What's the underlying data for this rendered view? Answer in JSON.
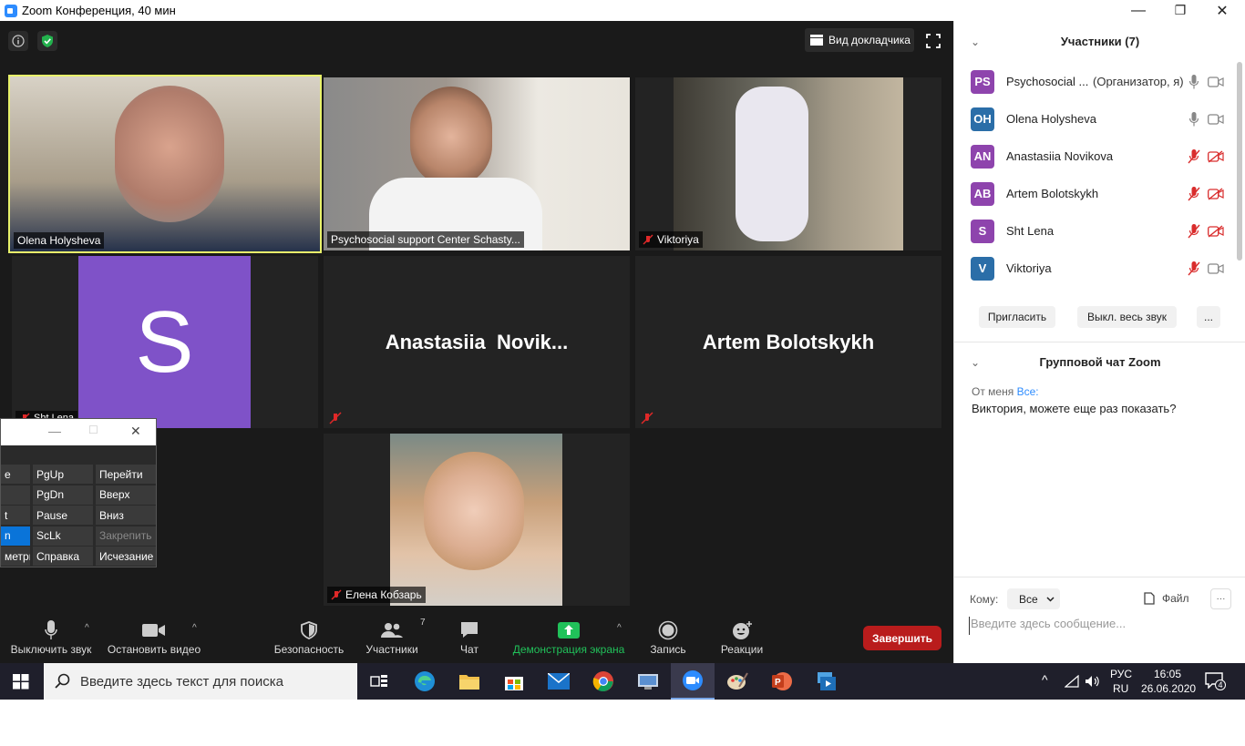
{
  "window": {
    "title": "Zoom Конференция, 40 мин",
    "minimize": "—",
    "maximize": "❐",
    "close": "✕"
  },
  "toolbar": {
    "speaker_view": "Вид докладчика"
  },
  "tiles": [
    {
      "name": "Olena Holysheva",
      "active": true
    },
    {
      "name": "Psychosocial support Center Schasty..."
    },
    {
      "name": "Viktoriya",
      "muted": true
    },
    {
      "name": "Sht Lena",
      "initial": "S",
      "muted": true
    },
    {
      "name": "Anastasiia  Novik...",
      "muted": true
    },
    {
      "name": "Artem Bolotskykh",
      "muted": true
    },
    {
      "name": "Елена Кобзарь",
      "muted": true
    }
  ],
  "keyboard": {
    "col1": [
      "e",
      "",
      "t",
      "n",
      "метрь"
    ],
    "col2": [
      "PgUp",
      "PgDn",
      "Pause",
      "ScLk",
      "Справка"
    ],
    "col3": [
      "Перейти",
      "Вверх",
      "Вниз",
      "Закрепить",
      "Исчезание"
    ]
  },
  "controls": {
    "mute": "Выключить звук",
    "video": "Остановить видео",
    "security": "Безопасность",
    "participants": "Участники",
    "participants_count": "7",
    "chat": "Чат",
    "share": "Демонстрация экрана",
    "record": "Запись",
    "reactions": "Реакции",
    "end": "Завершить"
  },
  "participants_panel": {
    "title": "Участники (7)",
    "people": [
      {
        "initials": "PS",
        "name": "Psychosocial ...",
        "role": "(Организатор, я)",
        "color": "#8e44ad",
        "mic": "on",
        "cam": "on"
      },
      {
        "initials": "OH",
        "name": "Olena Holysheva",
        "color": "#2b6ea8",
        "mic": "on",
        "cam": "on"
      },
      {
        "initials": "AN",
        "name": "Anastasiia Novikova",
        "color": "#8e44ad",
        "mic": "off",
        "cam": "off"
      },
      {
        "initials": "AB",
        "name": "Artem Bolotskykh",
        "color": "#8e44ad",
        "mic": "off",
        "cam": "off"
      },
      {
        "initials": "S",
        "name": "Sht Lena",
        "color": "#8e44ad",
        "mic": "off",
        "cam": "off"
      },
      {
        "initials": "V",
        "name": "Viktoriya",
        "color": "#2b6ea8",
        "mic": "off",
        "cam": "on"
      }
    ],
    "invite": "Пригласить",
    "mute_all": "Выкл. весь звук",
    "more": "..."
  },
  "chat": {
    "title": "Групповой чат Zoom",
    "from": "От меня",
    "to": "Все:",
    "message": "Виктория, можете еще раз показать?",
    "to_label": "Кому:",
    "to_value": "Все",
    "file": "Файл",
    "more": "···",
    "placeholder": "Введите здесь сообщение..."
  },
  "taskbar": {
    "search_placeholder": "Введите здесь текст для поиска",
    "lang1": "РУС",
    "lang2": "RU",
    "time": "16:05",
    "date": "26.06.2020",
    "notifications": "4"
  },
  "colors": {
    "accent": "#2d8cff",
    "end": "#b91c1c",
    "share": "#21c15a",
    "active_border": "#e8f26a"
  }
}
